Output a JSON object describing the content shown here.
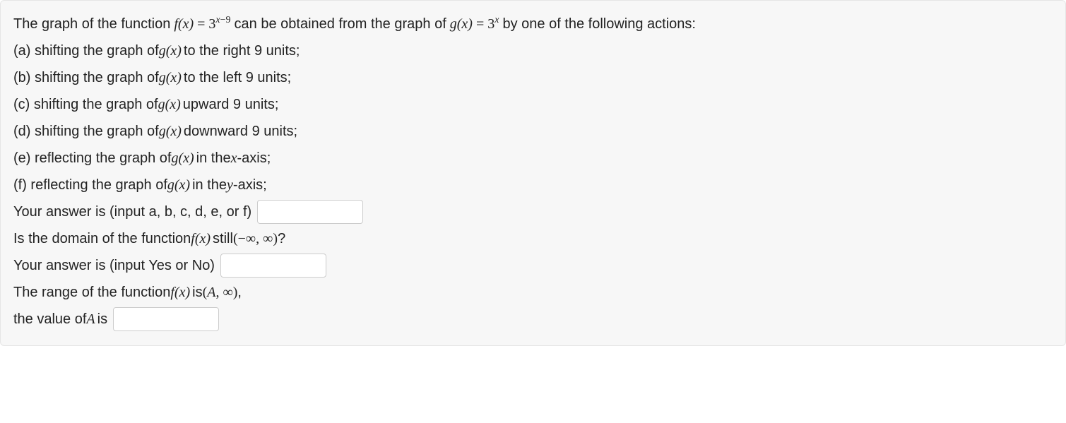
{
  "intro": {
    "p1": "The graph of the function ",
    "fx": "f(x)",
    "eq": " = ",
    "base1": "3",
    "exp1_a": "x",
    "exp1_b": "−9",
    "p2": " can be obtained from the graph of ",
    "gx": "g(x)",
    "base2": "3",
    "exp2": "x",
    "p3": " by one of the following actions:"
  },
  "options": {
    "a": {
      "pre": "(a) shifting the graph of ",
      "fn": "g(x)",
      "post": " to the right 9 units;"
    },
    "b": {
      "pre": "(b) shifting the graph of ",
      "fn": "g(x)",
      "post": " to the left 9 units;"
    },
    "c": {
      "pre": "(c) shifting the graph of ",
      "fn": "g(x)",
      "post": " upward 9 units;"
    },
    "d": {
      "pre": "(d) shifting the graph of ",
      "fn": "g(x)",
      "post": " downward 9 units;"
    },
    "e": {
      "pre": "(e) reflecting the graph of ",
      "fn": "g(x)",
      "mid": " in the ",
      "var": "x",
      "post": "-axis;"
    },
    "f": {
      "pre": "(f) reflecting the graph of ",
      "fn": "g(x)",
      "mid": " in the ",
      "var": "y",
      "post": "-axis;"
    }
  },
  "q1": {
    "label": "Your answer is (input a, b, c, d, e, or f)"
  },
  "q2": {
    "pre": "Is the domain of the function ",
    "fn": "f(x)",
    "mid": " still ",
    "expr": "(−∞, ∞)",
    "post": "?"
  },
  "q3": {
    "label": "Your answer is (input Yes or No)"
  },
  "q4": {
    "pre": "The range of the function ",
    "fn": "f(x)",
    "mid": " is ",
    "expr1": "(",
    "A": "A",
    "expr2": ", ∞)",
    "post": ","
  },
  "q5": {
    "pre": "the value of ",
    "A": "A",
    "post": " is"
  }
}
